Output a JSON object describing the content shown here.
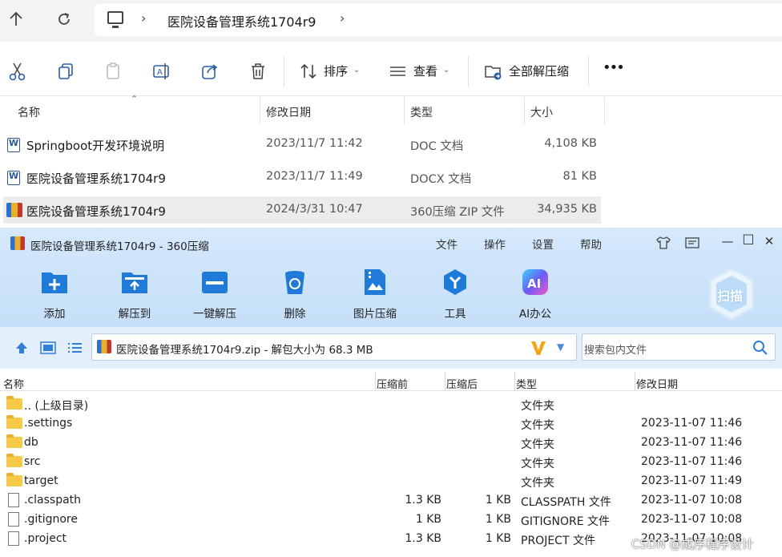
{
  "explorer": {
    "breadcrumb": {
      "title": "医院设备管理系统1704r9"
    },
    "toolbar": {
      "sort_label": "排序",
      "view_label": "查看",
      "extract_all_label": "全部解压缩",
      "more_label": "•••"
    },
    "columns": {
      "name": "名称",
      "modified": "修改日期",
      "type": "类型",
      "size": "大小"
    },
    "files": [
      {
        "name": "Springboot开发环境说明",
        "modified": "2023/11/7 11:42",
        "type": "DOC 文档",
        "size": "4,108 KB",
        "icon": "word-doc-icon"
      },
      {
        "name": "医院设备管理系统1704r9",
        "modified": "2023/11/7 11:49",
        "type": "DOCX 文档",
        "size": "81 KB",
        "icon": "word-doc-icon"
      },
      {
        "name": "医院设备管理系统1704r9",
        "modified": "2024/3/31 10:47",
        "type": "360压缩 ZIP 文件",
        "size": "34,935 KB",
        "icon": "zip-archive-icon",
        "selected": true
      }
    ]
  },
  "zip360": {
    "window_title": "医院设备管理系统1704r9 - 360压缩",
    "menu": [
      "文件",
      "操作",
      "设置",
      "帮助"
    ],
    "tools": [
      {
        "label": "添加",
        "icon": "add-icon"
      },
      {
        "label": "解压到",
        "icon": "extract-to-icon"
      },
      {
        "label": "一键解压",
        "icon": "one-click-extract-icon"
      },
      {
        "label": "删除",
        "icon": "recycle-bin-icon"
      },
      {
        "label": "图片压缩",
        "icon": "image-compress-icon"
      },
      {
        "label": "工具",
        "icon": "tools-icon"
      },
      {
        "label": "AI办公",
        "icon": "ai-office-icon"
      }
    ],
    "scan_label": "扫描",
    "path_text": "医院设备管理系统1704r9.zip - 解包大小为 68.3 MB",
    "search_placeholder": "搜索包内文件",
    "columns": {
      "name": "名称",
      "before": "压缩前",
      "after": "压缩后",
      "type": "类型",
      "modified": "修改日期"
    },
    "entries": [
      {
        "name": ".. (上级目录)",
        "before": "",
        "after": "",
        "type": "文件夹",
        "modified": "",
        "kind": "folder"
      },
      {
        "name": ".settings",
        "before": "",
        "after": "",
        "type": "文件夹",
        "modified": "2023-11-07 11:46",
        "kind": "folder"
      },
      {
        "name": "db",
        "before": "",
        "after": "",
        "type": "文件夹",
        "modified": "2023-11-07 11:46",
        "kind": "folder"
      },
      {
        "name": "src",
        "before": "",
        "after": "",
        "type": "文件夹",
        "modified": "2023-11-07 11:46",
        "kind": "folder"
      },
      {
        "name": "target",
        "before": "",
        "after": "",
        "type": "文件夹",
        "modified": "2023-11-07 11:49",
        "kind": "folder"
      },
      {
        "name": ".classpath",
        "before": "1.3 KB",
        "after": "1 KB",
        "type": "CLASSPATH 文件",
        "modified": "2023-11-07 10:08",
        "kind": "file"
      },
      {
        "name": ".gitignore",
        "before": "1 KB",
        "after": "1 KB",
        "type": "GITIGNORE 文件",
        "modified": "2023-11-07 10:08",
        "kind": "file"
      },
      {
        "name": ".project",
        "before": "1.3 KB",
        "after": "1 KB",
        "type": "PROJECT 文件",
        "modified": "2023-11-07 10:08",
        "kind": "file"
      }
    ]
  },
  "watermark": "CSDN @成序程序设计"
}
